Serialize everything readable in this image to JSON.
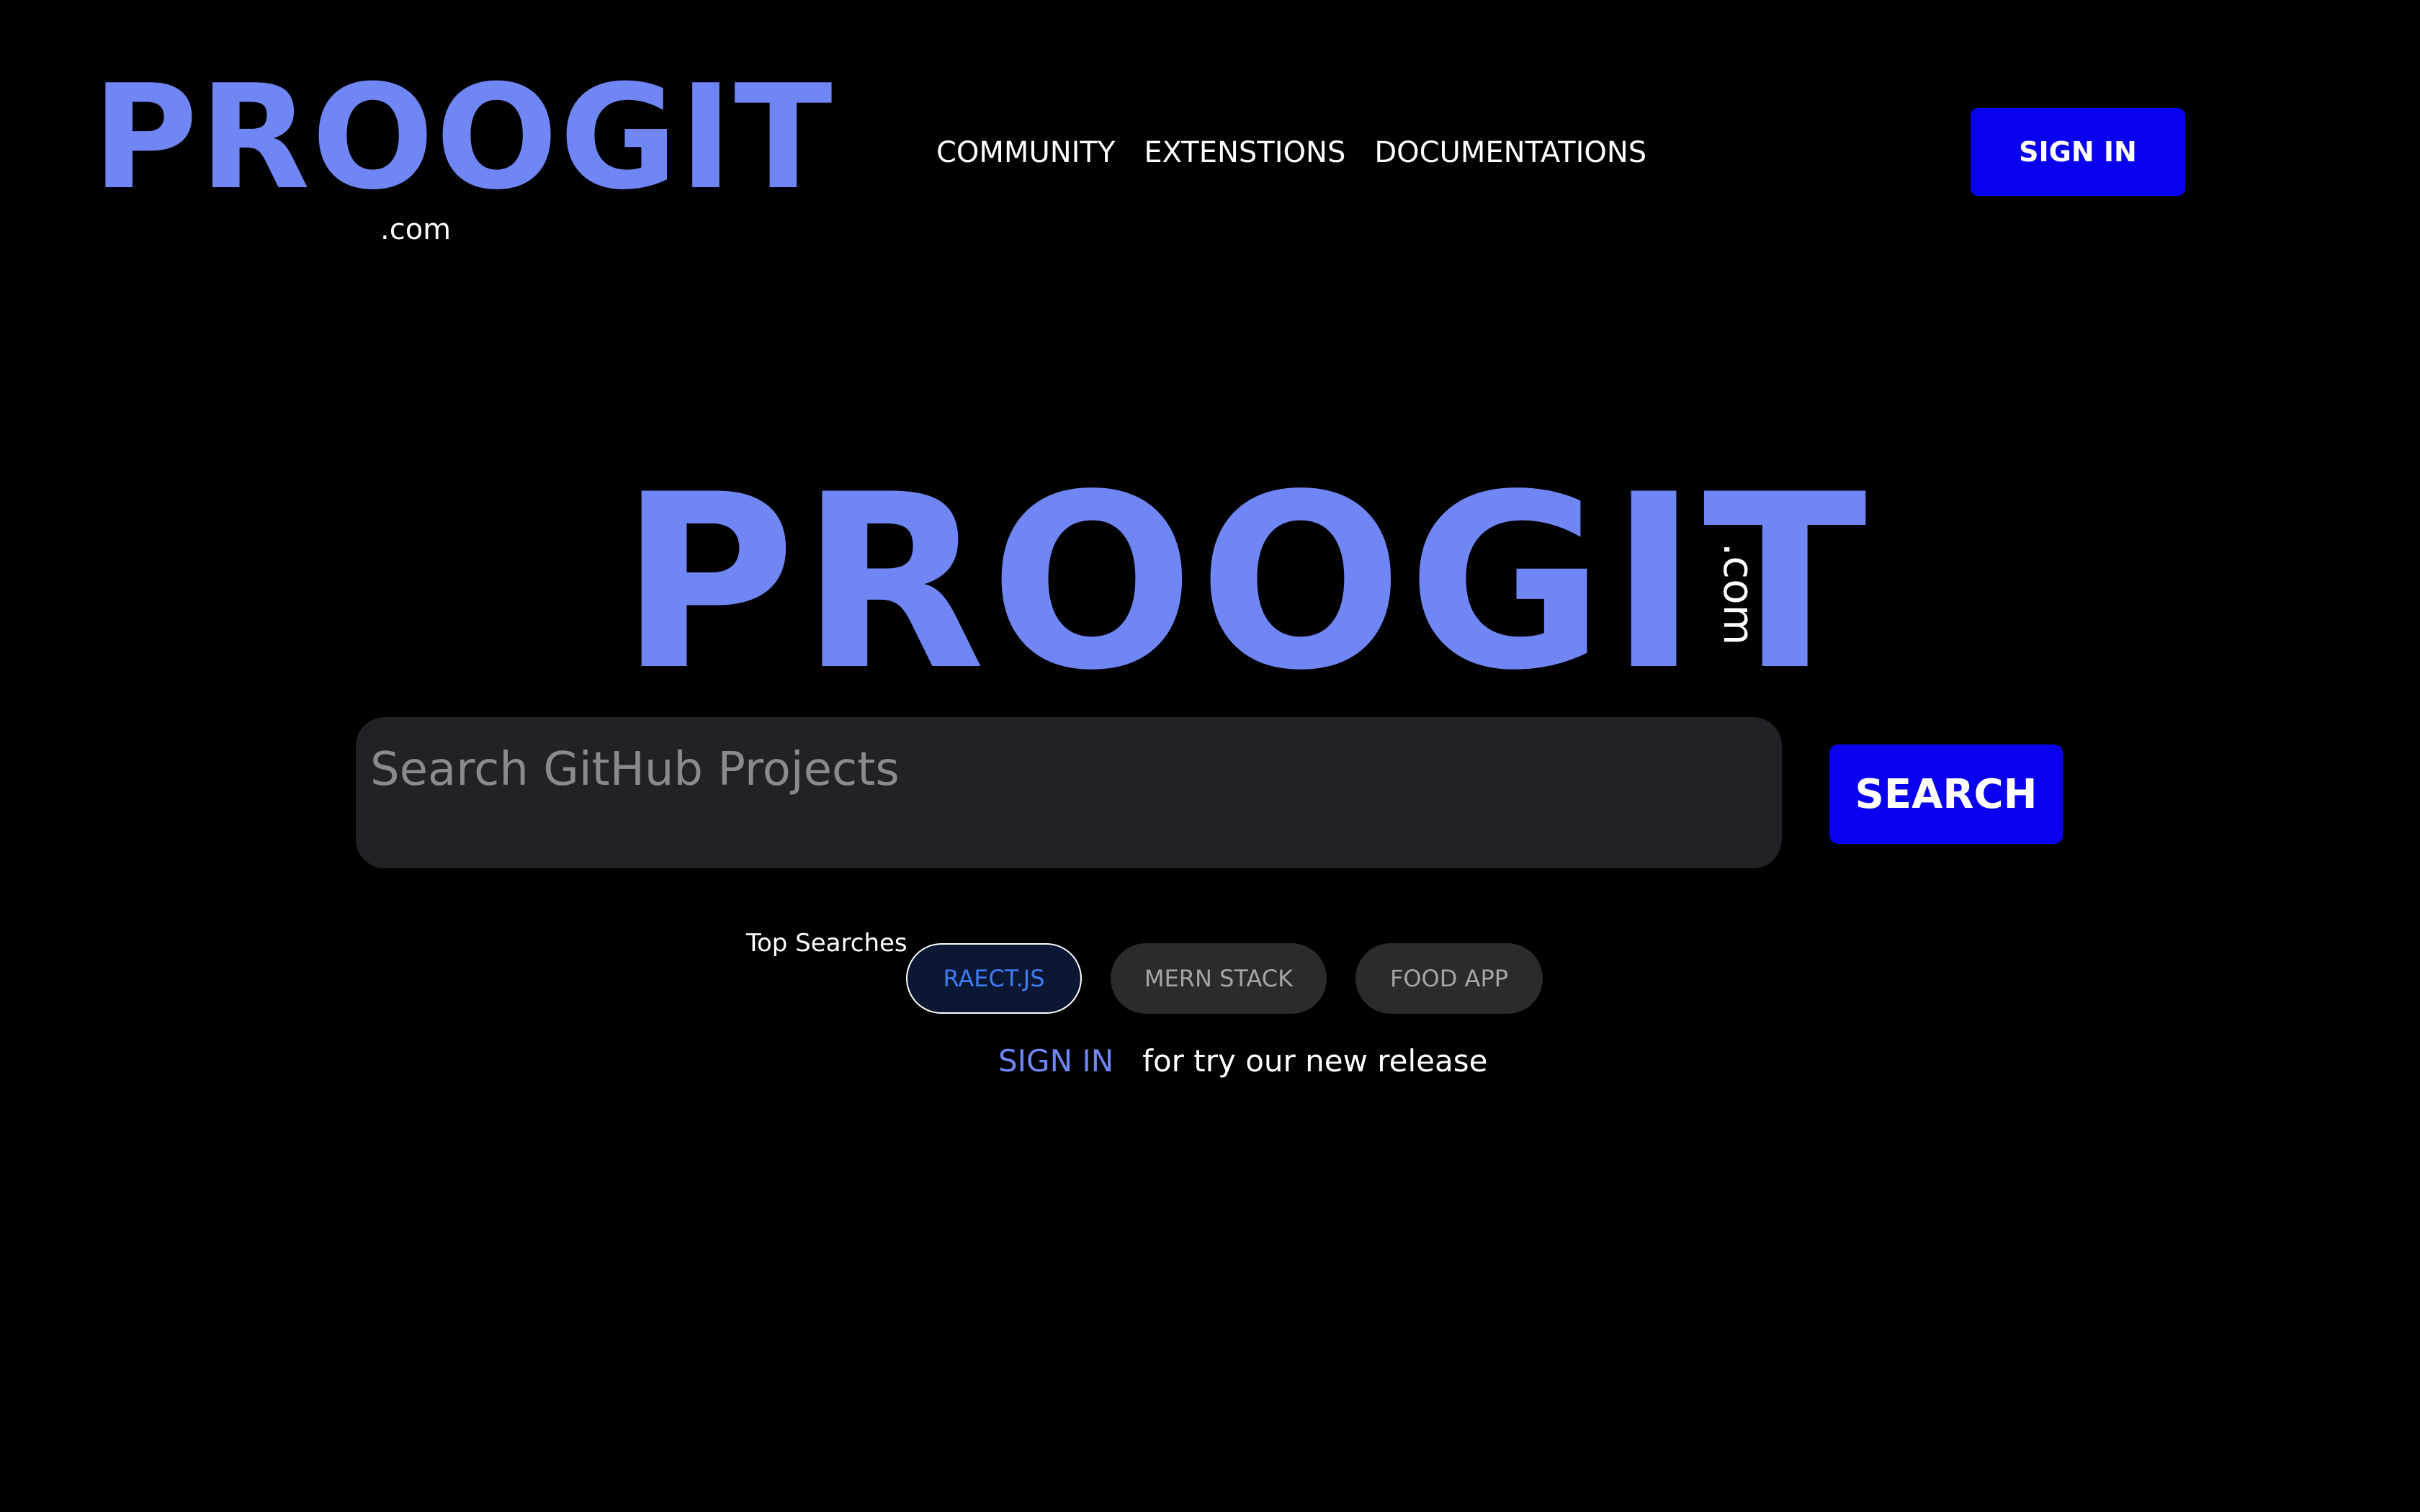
{
  "header": {
    "logo_word": "PROOGIT",
    "logo_suffix": ".com",
    "nav": [
      {
        "label": "COMMUNITY"
      },
      {
        "label": "EXTENSTIONS"
      },
      {
        "label": "DOCUMENTATIONS"
      }
    ],
    "signin_label": "SIGN IN"
  },
  "hero": {
    "logo_word": "PROOGIT",
    "logo_suffix": ".com"
  },
  "search": {
    "placeholder": "Search GitHub Projects",
    "value": "",
    "button_label": "SEARCH"
  },
  "top_searches": {
    "label": "Top Searches",
    "chips": [
      {
        "label": "RAECT.JS",
        "active": true
      },
      {
        "label": "MERN STACK",
        "active": false
      },
      {
        "label": "FOOD APP",
        "active": false
      }
    ]
  },
  "promo": {
    "link_label": "SIGN IN",
    "text": "for try our new release"
  },
  "colors": {
    "background": "#000000",
    "brand": "#7086f5",
    "button": "#0a00f0",
    "search_field": "#212126",
    "chip": "#2b2b2b",
    "chip_active_text": "#3f7cf4"
  }
}
